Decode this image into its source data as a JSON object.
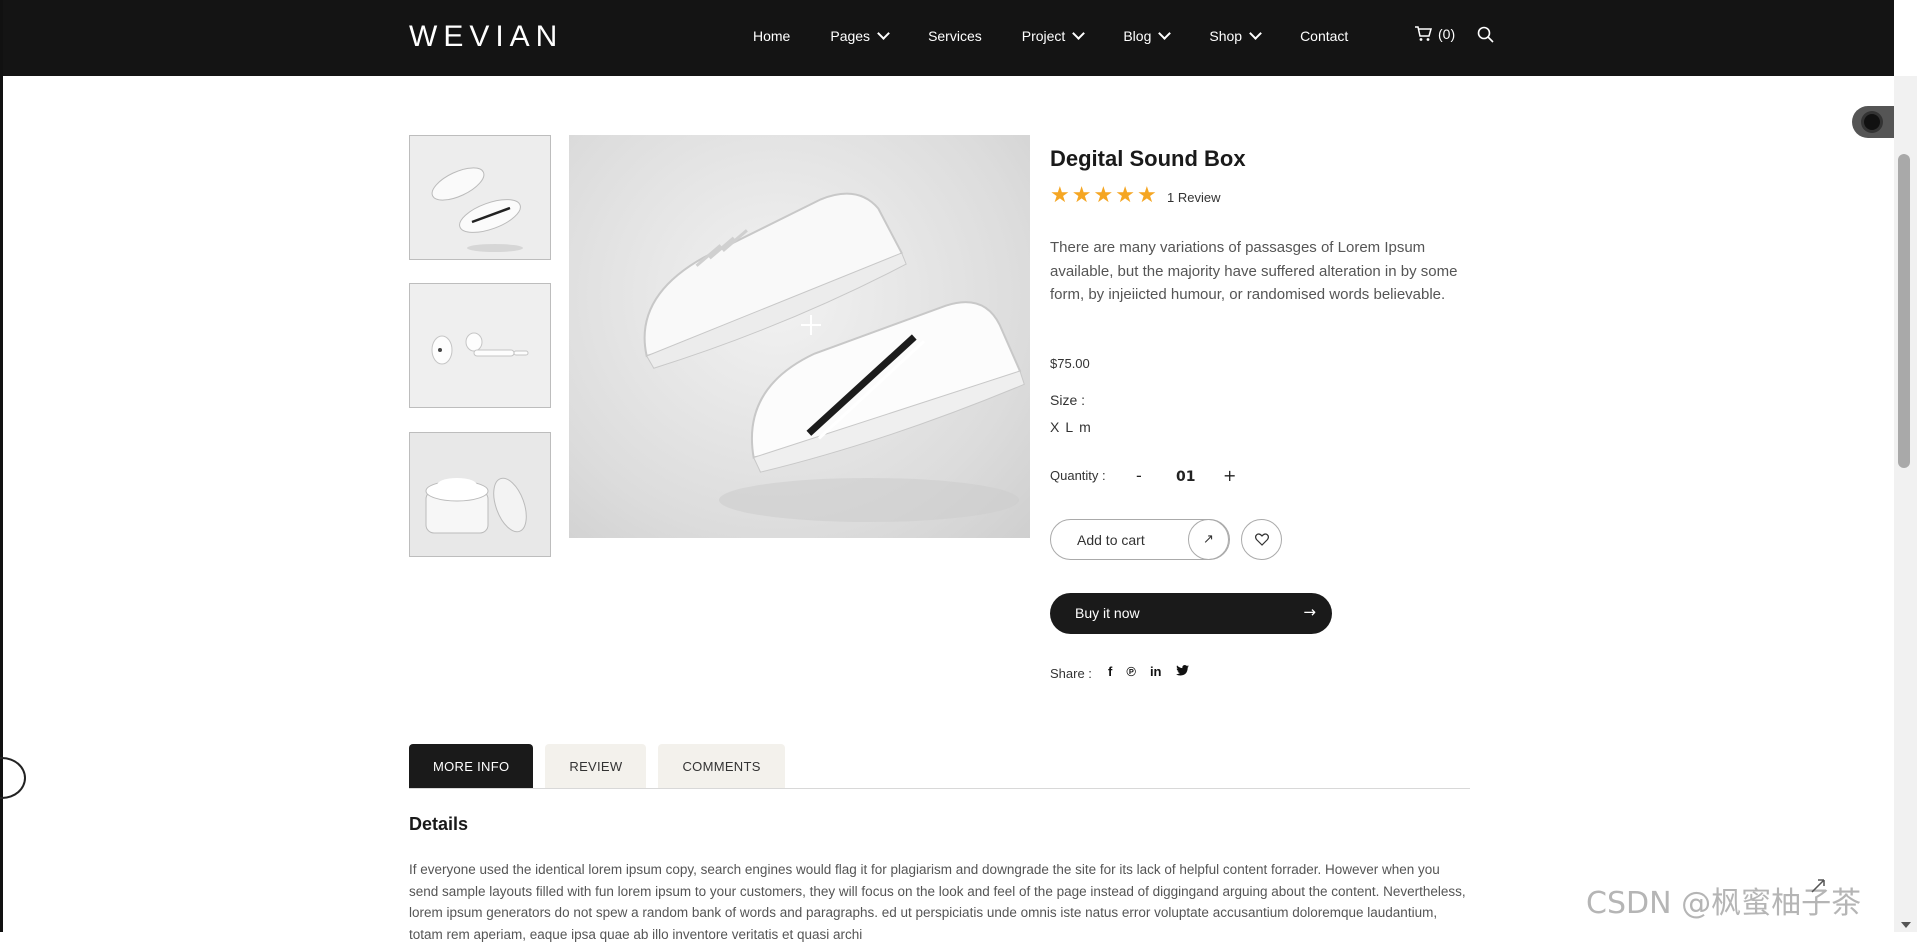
{
  "header": {
    "logo": "WEVIAN",
    "nav": [
      {
        "label": "Home",
        "dropdown": false
      },
      {
        "label": "Pages",
        "dropdown": true
      },
      {
        "label": "Services",
        "dropdown": false
      },
      {
        "label": "Project",
        "dropdown": true
      },
      {
        "label": "Blog",
        "dropdown": true
      },
      {
        "label": "Shop",
        "dropdown": true
      },
      {
        "label": "Contact",
        "dropdown": false
      }
    ],
    "cart_count": "(0)"
  },
  "gallery": {
    "thumbnails": [
      "sneakers",
      "earbuds",
      "cream-jar"
    ]
  },
  "product": {
    "title": "Degital Sound Box",
    "rating": 5,
    "reviews": "1 Review",
    "description": "There are many variations of passasges of Lorem Ipsum available, but the majority have suffered alteration in by some form, by injeiicted humour, or randomised words believable.",
    "price": "$75.00",
    "size_label": "Size :",
    "sizes": [
      "X",
      "L",
      "m"
    ],
    "quantity_label": "Quantity :",
    "quantity_minus": "-",
    "quantity": "01",
    "quantity_plus": "+",
    "add_to_cart": "Add to cart",
    "buy_now": "Buy it now",
    "share_label": "Share :",
    "share_icons": [
      "facebook-icon",
      "pinterest-icon",
      "linkedin-icon",
      "twitter-icon"
    ]
  },
  "tabs": [
    {
      "label": "MORE INFO",
      "active": true
    },
    {
      "label": "REVIEW",
      "active": false
    },
    {
      "label": "COMMENTS",
      "active": false
    }
  ],
  "details": {
    "title": "Details",
    "text": "If everyone used the identical lorem ipsum copy, search engines would flag it for plagiarism and downgrade the site for its lack of helpful content forrader. However when you send sample layouts filled with fun lorem ipsum to your customers, they will focus on the look and feel of the page instead of diggingand arguing about the content. Nevertheless, lorem ipsum generators do not spew a random bank of words and paragraphs. ed ut perspiciatis unde omnis iste natus error voluptate accusantium doloremque laudantium, totam rem aperiam, eaque ipsa quae ab illo inventore veritatis et quasi archi"
  },
  "watermark": "CSDN @枫蜜柚子茶",
  "colors": {
    "header_bg": "#141414",
    "star": "#f5a623",
    "dark_button": "#1a1a1a",
    "tab_bg": "#f3f1ec"
  }
}
